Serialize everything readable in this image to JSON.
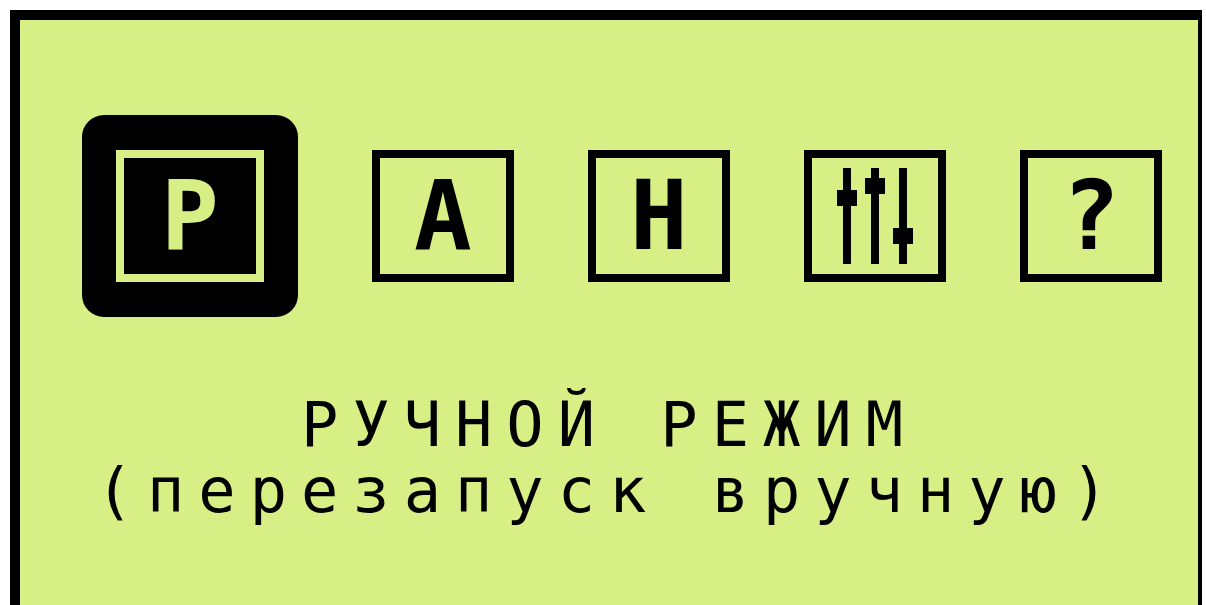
{
  "menu": [
    {
      "kind": "letter",
      "label": "Р",
      "selected": true
    },
    {
      "kind": "letter",
      "label": "А",
      "selected": false
    },
    {
      "kind": "letter",
      "label": "Н",
      "selected": false
    },
    {
      "kind": "sliders",
      "selected": false
    },
    {
      "kind": "letter",
      "label": "?",
      "selected": false
    }
  ],
  "mode": {
    "title": "РУЧНОЙ РЕЖИМ",
    "subtitle": "(перезапуск вручную)"
  }
}
